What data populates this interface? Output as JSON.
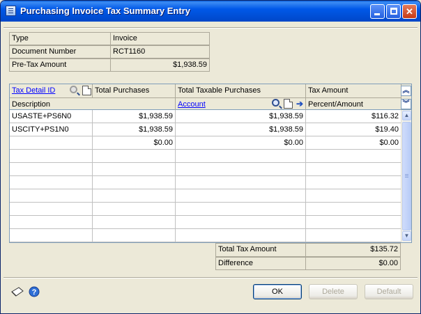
{
  "window": {
    "title": "Purchasing Invoice Tax Summary Entry",
    "title_bar_color": "#0058e8"
  },
  "summary": {
    "type_label": "Type",
    "type_value": "Invoice",
    "doc_label": "Document Number",
    "doc_value": "RCT1160",
    "pretax_label": "Pre-Tax Amount",
    "pretax_value": "$1,938.59"
  },
  "grid": {
    "headers_row1": {
      "tax_detail_id": "Tax Detail ID",
      "total_purchases": "Total Purchases",
      "total_taxable": "Total Taxable Purchases",
      "tax_amount": "Tax Amount"
    },
    "headers_row2": {
      "description": "Description",
      "account": "Account",
      "percent_amount": "Percent/Amount"
    },
    "rows": [
      {
        "id": "USASTE+PS6N0",
        "total": "$1,938.59",
        "taxable": "$1,938.59",
        "tax": "$116.32"
      },
      {
        "id": "USCITY+PS1N0",
        "total": "$1,938.59",
        "taxable": "$1,938.59",
        "tax": "$19.40"
      },
      {
        "id": "",
        "total": "$0.00",
        "taxable": "$0.00",
        "tax": "$0.00"
      },
      {
        "id": "",
        "total": "",
        "taxable": "",
        "tax": ""
      },
      {
        "id": "",
        "total": "",
        "taxable": "",
        "tax": ""
      },
      {
        "id": "",
        "total": "",
        "taxable": "",
        "tax": ""
      },
      {
        "id": "",
        "total": "",
        "taxable": "",
        "tax": ""
      },
      {
        "id": "",
        "total": "",
        "taxable": "",
        "tax": ""
      },
      {
        "id": "",
        "total": "",
        "taxable": "",
        "tax": ""
      },
      {
        "id": "",
        "total": "",
        "taxable": "",
        "tax": ""
      }
    ]
  },
  "totals": {
    "total_tax_label": "Total Tax Amount",
    "total_tax_value": "$135.72",
    "difference_label": "Difference",
    "difference_value": "$0.00"
  },
  "buttons": {
    "ok": "OK",
    "delete": "Delete",
    "default": "Default"
  },
  "icons": {
    "minimize": "minimize-icon",
    "maximize": "maximize-icon",
    "close": "close-icon",
    "lookup": "lookup-icon",
    "new_document": "new-document-icon",
    "expand": "expand-icon",
    "note": "note-icon",
    "help": "help-icon"
  }
}
